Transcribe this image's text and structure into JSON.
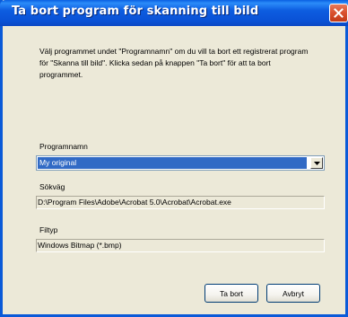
{
  "window": {
    "title": "Ta bort program för skanning till bild"
  },
  "description": "Välj programmet undet \"Programnamn\" om du vill ta bort ett registrerat program för \"Skanna till bild\". Klicka sedan på knappen \"Ta bort\" för att ta bort programmet.",
  "program": {
    "label": "Programnamn",
    "selected": "My original"
  },
  "path": {
    "label": "Sökväg",
    "value": "D:\\Program Files\\Adobe\\Acrobat 5.0\\Acrobat\\Acrobat.exe"
  },
  "filetype": {
    "label": "Filtyp",
    "value": "Windows Bitmap (*.bmp)"
  },
  "buttons": {
    "remove": "Ta bort",
    "cancel": "Avbryt"
  },
  "icons": {
    "close": "close-icon",
    "dropdown": "chevron-down-icon"
  },
  "colors": {
    "titlebar": "#0a5ad8",
    "selection": "#316ac5",
    "dialog_bg": "#ece9d8",
    "close_button": "#d9502e"
  }
}
